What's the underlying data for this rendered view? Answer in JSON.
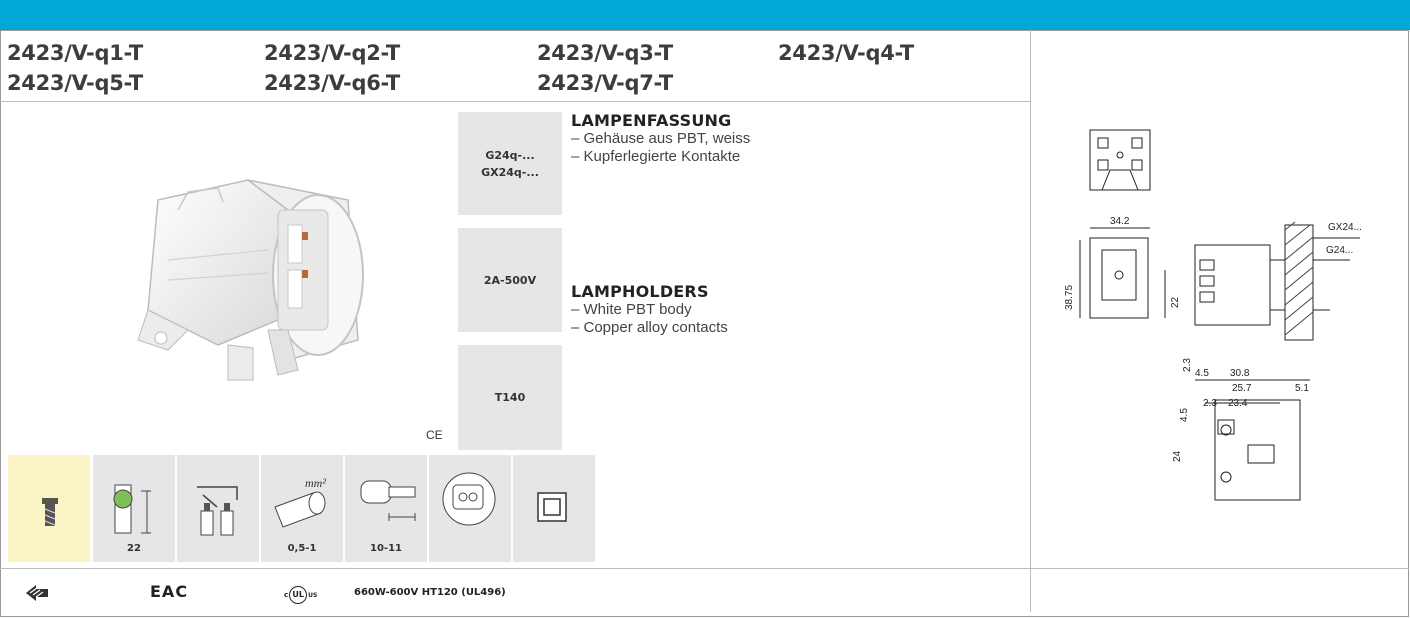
{
  "header": {
    "codes": [
      "2423/V-q1-T",
      "2423/V-q2-T",
      "2423/V-q3-T",
      "2423/V-q4-T",
      "2423/V-q5-T",
      "2423/V-q6-T",
      "2423/V-q7-T"
    ]
  },
  "specs": {
    "base": [
      "G24q-...",
      "GX24q-..."
    ],
    "rating": "2A-500V",
    "temp": "T140"
  },
  "description": {
    "de_title": "LAMPENFASSUNG",
    "de_items": [
      "– Gehäuse aus PBT, weiss",
      "– Kupferlegierte Kontakte"
    ],
    "en_title": "LAMPHOLDERS",
    "en_items": [
      "– White PBT body",
      "– Copper alloy contacts"
    ]
  },
  "ce_mark": "CE",
  "icons": [
    {
      "icon": "screw-icon",
      "caption": ""
    },
    {
      "icon": "panel-thickness-icon",
      "caption": "22"
    },
    {
      "icon": "push-in-terminal-icon",
      "caption": ""
    },
    {
      "icon": "wire-cross-section-icon",
      "caption": "0,5-1"
    },
    {
      "icon": "strip-length-icon",
      "caption": "10-11"
    },
    {
      "icon": "test-plug-icon",
      "caption": ""
    },
    {
      "icon": "class-ii-icon",
      "caption": ""
    }
  ],
  "icon_texts": {
    "mm2": "mm²"
  },
  "footer": {
    "eac": "EAC",
    "ul_c": "c",
    "ul_mark": "UL",
    "ul_us": "US",
    "ul_text": "660W-600V HT120 (UL496)"
  },
  "drawing": {
    "dims": [
      "34.2",
      "38.75",
      "22",
      "2.3",
      "GX24...",
      "G24...",
      "4.5",
      "30.8",
      "25.7",
      "5.1",
      "2.3",
      "23.4",
      "4.5",
      "24"
    ]
  },
  "colors": {
    "accent": "#00a8d6",
    "spec_bg": "#e6e6e6",
    "highlight_bg": "#fbf4c6"
  }
}
